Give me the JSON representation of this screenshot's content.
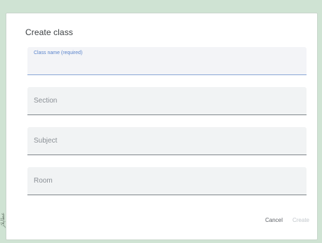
{
  "watermark": "عطاپلاز",
  "dialog": {
    "title": "Create class",
    "fields": [
      {
        "label": "Class name (required)",
        "value": "",
        "focused": true
      },
      {
        "label": "Section",
        "value": ""
      },
      {
        "label": "Subject",
        "value": ""
      },
      {
        "label": "Room",
        "value": ""
      }
    ],
    "actions": {
      "cancel": "Cancel",
      "create": "Create",
      "create_enabled": false
    }
  },
  "colors": {
    "page_background": "#cfe3d3",
    "dialog_background": "#ffffff",
    "field_background": "#f1f3f4",
    "focused_label": "#5a84cc",
    "cancel_text": "#5f6368",
    "disabled_text": "#c2c7cc"
  }
}
